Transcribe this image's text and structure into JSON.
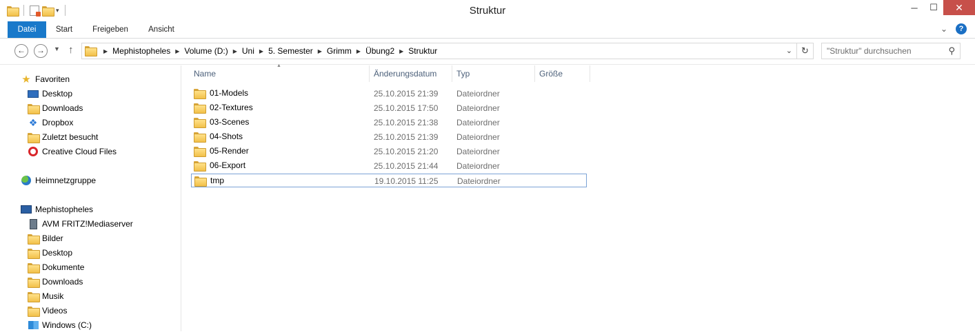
{
  "window": {
    "title": "Struktur"
  },
  "ribbon": {
    "tabs": [
      "Datei",
      "Start",
      "Freigeben",
      "Ansicht"
    ],
    "help": "?"
  },
  "nav": {
    "breadcrumbs": [
      "Mephistopheles",
      "Volume (D:)",
      "Uni",
      "5. Semester",
      "Grimm",
      "Übung2",
      "Struktur"
    ],
    "search_placeholder": "\"Struktur\" durchsuchen"
  },
  "sidebar": {
    "favorites": {
      "label": "Favoriten",
      "items": [
        "Desktop",
        "Downloads",
        "Dropbox",
        "Zuletzt besucht",
        "Creative Cloud Files"
      ]
    },
    "homegroup": {
      "label": "Heimnetzgruppe"
    },
    "computer": {
      "label": "Mephistopheles",
      "items": [
        "AVM FRITZ!Mediaserver",
        "Bilder",
        "Desktop",
        "Dokumente",
        "Downloads",
        "Musik",
        "Videos",
        "Windows (C:)"
      ]
    }
  },
  "columns": {
    "name": "Name",
    "date": "Änderungsdatum",
    "type": "Typ",
    "size": "Größe"
  },
  "files": [
    {
      "name": "01-Models",
      "date": "25.10.2015 21:39",
      "type": "Dateiordner"
    },
    {
      "name": "02-Textures",
      "date": "25.10.2015 17:50",
      "type": "Dateiordner"
    },
    {
      "name": "03-Scenes",
      "date": "25.10.2015 21:38",
      "type": "Dateiordner"
    },
    {
      "name": "04-Shots",
      "date": "25.10.2015 21:39",
      "type": "Dateiordner"
    },
    {
      "name": "05-Render",
      "date": "25.10.2015 21:20",
      "type": "Dateiordner"
    },
    {
      "name": "06-Export",
      "date": "25.10.2015 21:44",
      "type": "Dateiordner"
    },
    {
      "name": "tmp",
      "date": "19.10.2015 11:25",
      "type": "Dateiordner"
    }
  ],
  "colors": {
    "accent": "#1979ca",
    "close": "#c7504a",
    "header_text": "#4c607a",
    "selection_border": "#7ba2d6"
  }
}
